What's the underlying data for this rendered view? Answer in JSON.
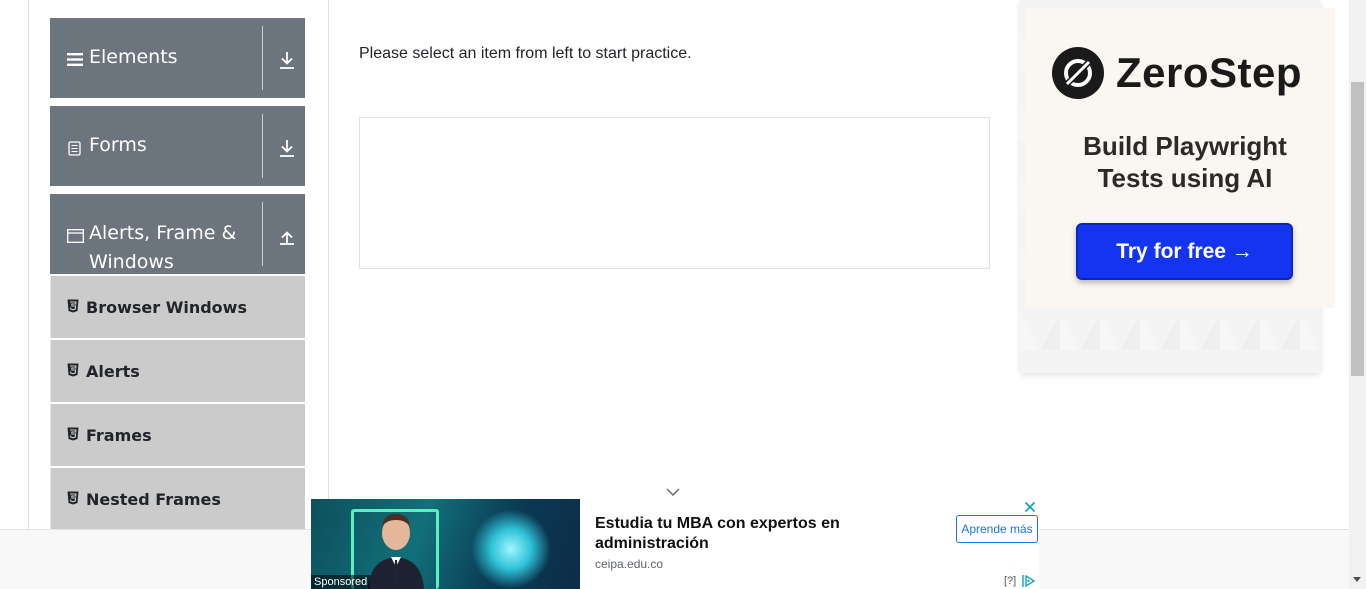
{
  "sidebar": {
    "groups": [
      {
        "label": "Elements",
        "icon": "hamburger-icon",
        "arrow": "download-arrow-icon"
      },
      {
        "label": "Forms",
        "icon": "document-icon",
        "arrow": "download-arrow-icon"
      },
      {
        "label_line1": "Alerts, Frame &",
        "label_line2": "Windows",
        "icon": "window-icon",
        "arrow": "upload-arrow-icon"
      }
    ],
    "items": [
      {
        "label": "Browser Windows",
        "icon": "html5-icon"
      },
      {
        "label": "Alerts",
        "icon": "html5-icon"
      },
      {
        "label": "Frames",
        "icon": "html5-icon"
      },
      {
        "label": "Nested Frames",
        "icon": "html5-icon"
      }
    ]
  },
  "main": {
    "message": "Please select an item from left to start practice."
  },
  "ad_right": {
    "brand": "ZeroStep",
    "tagline_line1": "Build Playwright",
    "tagline_line2": "Tests using AI",
    "cta": "Try for free →",
    "cta_color": "#1434f0"
  },
  "ad_bottom": {
    "headline": "Estudia tu MBA con expertos en administración",
    "domain": "ceipa.edu.co",
    "cta": "Aprende más",
    "sponsored": "Sponsored",
    "info": "[?]"
  },
  "colors": {
    "group_bg": "#6c757d",
    "item_bg": "#cbcbcb",
    "accent_blue": "#1a73e8"
  }
}
